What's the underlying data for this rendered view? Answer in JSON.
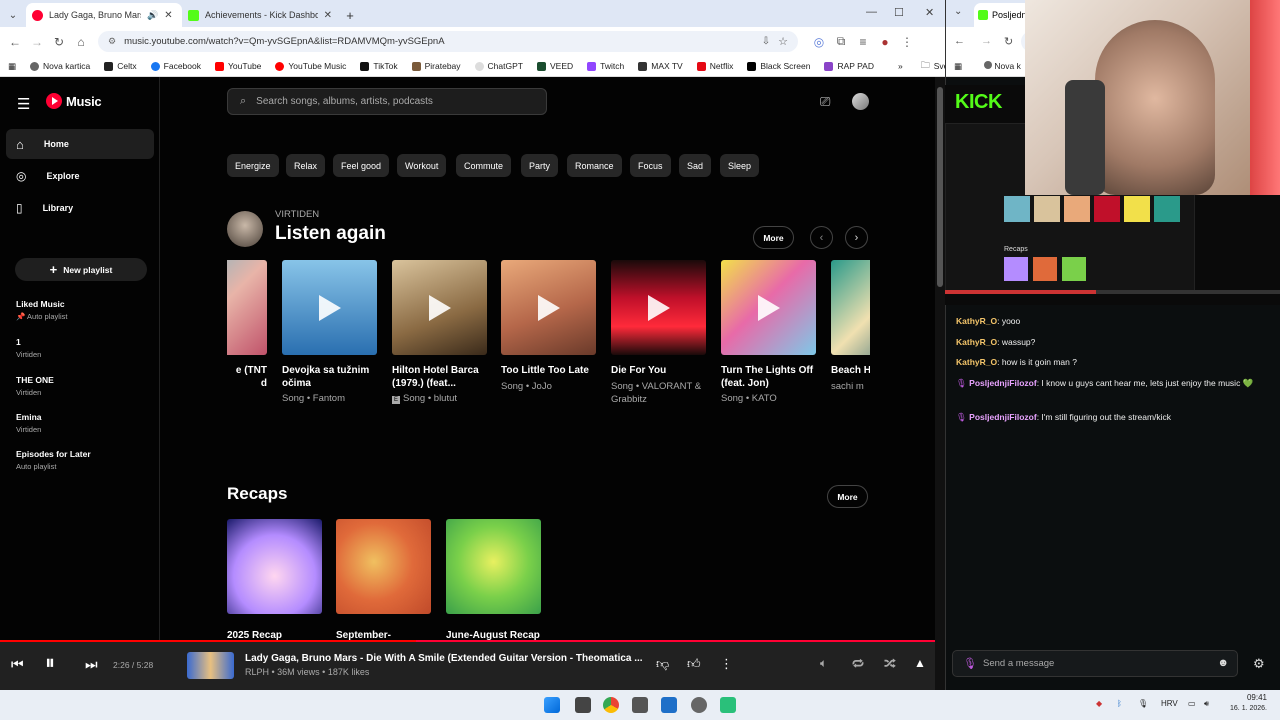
{
  "chrome": {
    "tabs": [
      {
        "title": "Lady Gaga, Bruno Mars - Di",
        "color": "#ff0033"
      },
      {
        "title": "Achievements - Kick Dashboard",
        "color": "#53fc18"
      }
    ],
    "url": "music.youtube.com/watch?v=Qm-yvSGEpnA&list=RDAMVMQm-yvSGEpnA",
    "bookmarks": [
      "Nova kartica",
      "Celtx",
      "Facebook",
      "YouTube",
      "YouTube Music",
      "TikTok",
      "Piratebay",
      "ChatGPT",
      "VEED",
      "Twitch",
      "MAX TV",
      "Netflix",
      "Black Screen",
      "RAP PAD"
    ],
    "bookmark_folder": "Sve oznake",
    "right_tab_title": "Posljednj",
    "right_bookmark": "Nova k"
  },
  "ytm": {
    "logo": "Music",
    "search_placeholder": "Search songs, albums, artists, podcasts",
    "nav": [
      {
        "label": "Home",
        "icon": "home-icon"
      },
      {
        "label": "Explore",
        "icon": "compass-icon"
      },
      {
        "label": "Library",
        "icon": "library-icon"
      }
    ],
    "new_playlist": "New playlist",
    "playlists": [
      {
        "name": "Liked Music",
        "sub": "Auto playlist"
      },
      {
        "name": "1",
        "sub": "Virtiden"
      },
      {
        "name": "THE ONE",
        "sub": "Virtiden"
      },
      {
        "name": "Emina",
        "sub": "Virtiden"
      },
      {
        "name": "Episodes for Later",
        "sub": "Auto playlist"
      }
    ],
    "chips": [
      "Energize",
      "Relax",
      "Feel good",
      "Workout",
      "Commute",
      "Party",
      "Romance",
      "Focus",
      "Sad",
      "Sleep"
    ],
    "listen_again": {
      "user": "VIRTIDEN",
      "title": "Listen again",
      "more": "More",
      "items": [
        {
          "title": "e (TNT\nd",
          "sub": ""
        },
        {
          "title": "Devojka sa tužnim očima",
          "sub": "Song • Fantom"
        },
        {
          "title": "Hilton Hotel Barca (1979.) (feat...",
          "sub": "Song • blutut"
        },
        {
          "title": "Too Little Too Late",
          "sub": "Song • JoJo"
        },
        {
          "title": "Die For You",
          "sub": "Song • VALORANT & Grabbitz"
        },
        {
          "title": "Turn The Lights Off (feat. Jon)",
          "sub": "Song • KATO"
        },
        {
          "title": "Beach H (Slowed",
          "sub": "sachi m"
        }
      ]
    },
    "recaps": {
      "title": "Recaps",
      "more": "More",
      "items": [
        "2025 Recap",
        "September-",
        "June-August Recap"
      ]
    },
    "player": {
      "time": "2:26 / 5:28",
      "progress": 0.445,
      "title": "Lady Gaga, Bruno Mars - Die With A Smile (Extended Guitar Version - Theomatica ...",
      "sub": "RLPH • 36M views • 187K likes"
    }
  },
  "kick": {
    "chat": [
      {
        "user": "KathyR_O",
        "text": "yooo",
        "color": "#f4c56a"
      },
      {
        "user": "KathyR_O",
        "text": "wassup?",
        "color": "#f4c56a"
      },
      {
        "user": "KathyR_O",
        "text": "how is it goin man ?",
        "color": "#f4c56a"
      },
      {
        "user": "PosljednjiFilozof",
        "text": "I know u guys cant hear me, lets just enjoy the music 💚",
        "color": "#e9a3ff"
      },
      {
        "user": "PosljednjiFilozof",
        "text": "I'm still figuring out the stream/kick",
        "color": "#e9a3ff"
      }
    ],
    "input_placeholder": "Send a message",
    "logo": "KICK",
    "preview_recaps": "Recaps"
  },
  "taskbar": {
    "lang": "HRV",
    "time": "09:41",
    "date": "16. 1. 2026."
  }
}
